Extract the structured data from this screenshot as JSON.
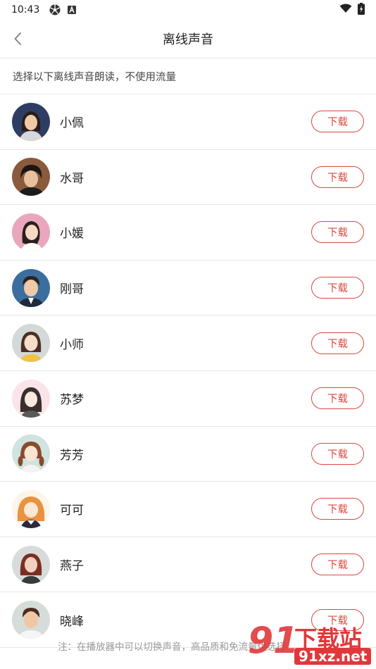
{
  "status_bar": {
    "time": "10:43",
    "icons": [
      "soccer-icon",
      "a-icon",
      "wifi-icon",
      "battery-icon"
    ]
  },
  "header": {
    "title": "离线声音",
    "back_icon": "chevron-left-icon"
  },
  "hint": "选择以下离线声音朗读，不使用流量",
  "voices": [
    {
      "name": "小佩",
      "button": "下载"
    },
    {
      "name": "水哥",
      "button": "下载"
    },
    {
      "name": "小媛",
      "button": "下载"
    },
    {
      "name": "刚哥",
      "button": "下载"
    },
    {
      "name": "小师",
      "button": "下载"
    },
    {
      "name": "苏梦",
      "button": "下载"
    },
    {
      "name": "芳芳",
      "button": "下载"
    },
    {
      "name": "可可",
      "button": "下载"
    },
    {
      "name": "燕子",
      "button": "下载"
    },
    {
      "name": "晓峰",
      "button": "下载"
    }
  ],
  "footer_note": "注：在播放器中可以切换声音，高品质和免流量供选择",
  "watermark": {
    "number": "91",
    "title": "下载站",
    "site": "91xz.net"
  },
  "colors": {
    "accent": "#d9493f",
    "divider": "#e6e6e6"
  }
}
